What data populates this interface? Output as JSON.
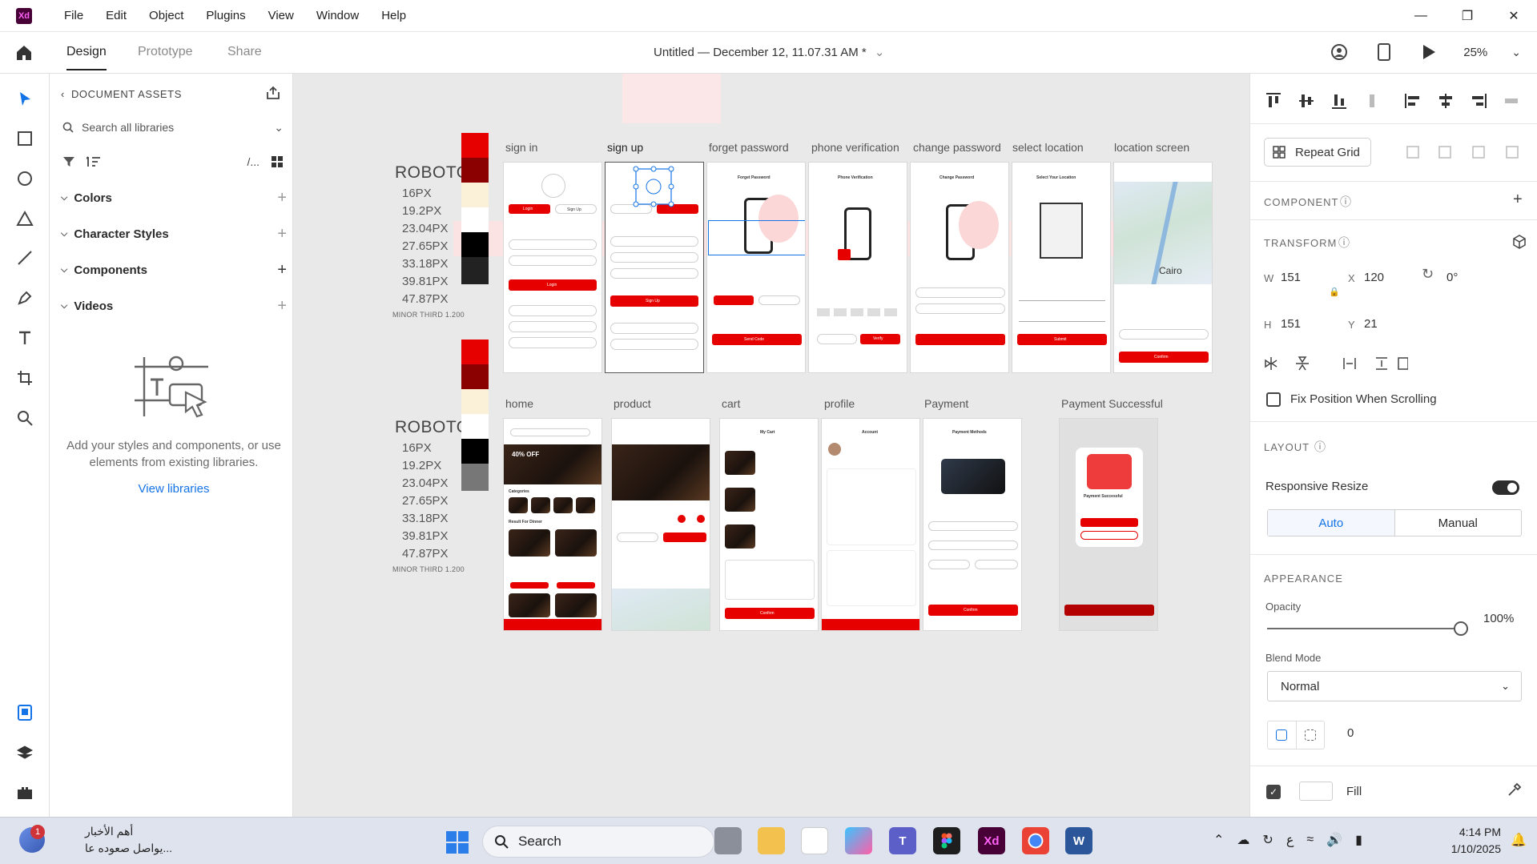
{
  "menu": [
    "File",
    "Edit",
    "Object",
    "Plugins",
    "View",
    "Window",
    "Help"
  ],
  "app_logo": "Xd",
  "modes": {
    "design": "Design",
    "prototype": "Prototype",
    "share": "Share"
  },
  "document_title": "Untitled — December 12, 11.07.31 AM *",
  "zoom": "25%",
  "assets": {
    "header": "DOCUMENT ASSETS",
    "search_placeholder": "Search all libraries",
    "filter_text": "/...",
    "sections": [
      "Colors",
      "Character Styles",
      "Components",
      "Videos"
    ],
    "empty_text": "Add your styles and components, or use elements from existing libraries.",
    "view_libraries": "View libraries"
  },
  "canvas": {
    "row1_labels": [
      "sign in",
      "sign up",
      "forget password",
      "phone verification",
      "change password",
      "select location",
      "location screen"
    ],
    "row2_labels": [
      "home",
      "product",
      "cart",
      "profile",
      "Payment",
      "Payment Successful"
    ],
    "typography": {
      "family": "ROBOTO",
      "sizes": [
        "16PX",
        "19.2PX",
        "23.04PX",
        "27.65PX",
        "33.18PX",
        "39.81PX",
        "47.87PX"
      ],
      "scale_note": "MINOR THIRD 1.200"
    },
    "palette": [
      "#e60000",
      "#8b0000",
      "#fbf1d9",
      "#ffffff",
      "#000000",
      "#222222"
    ],
    "palette2": [
      "#e60000",
      "#8b0000",
      "#fbf1d9",
      "#ffffff",
      "#000000",
      "#777777"
    ],
    "screen_text": {
      "login": "Login",
      "signup": "Sign Up",
      "forget_password": "Forget Password",
      "phone_verification": "Phone Verification",
      "change_password": "Change Password",
      "select_location": "Select Your Location",
      "location": "Location",
      "send_code": "Send Code",
      "verify": "Verify",
      "submit": "Submit",
      "confirm": "Confirm",
      "offer": "40% OFF",
      "categories": "Categories",
      "result_dinner": "Result For Dinner",
      "my_cart": "My Cart",
      "account": "Account",
      "payment_methods": "Payment Methods",
      "payment_success": "Payment Successful",
      "continue_shopping": "Continue Shopping",
      "track_delivery": "Track Delivery",
      "cairo": "Cairo"
    }
  },
  "props": {
    "repeat_grid": "Repeat Grid",
    "component_label": "COMPONENT",
    "transform_label": "TRANSFORM",
    "w_label": "W",
    "w_value": "151",
    "x_label": "X",
    "x_value": "120",
    "h_label": "H",
    "h_value": "151",
    "y_label": "Y",
    "y_value": "21",
    "rotation": "0°",
    "fix_position": "Fix Position When Scrolling",
    "layout_label": "LAYOUT",
    "responsive_resize": "Responsive Resize",
    "auto": "Auto",
    "manual": "Manual",
    "appearance_label": "APPEARANCE",
    "opacity_label": "Opacity",
    "opacity_value": "100%",
    "opacity_level": 1.0,
    "blend_label": "Blend Mode",
    "blend_value": "Normal",
    "corner_value": "0",
    "fill_label": "Fill"
  },
  "taskbar": {
    "news_badge": "1",
    "news_title": "أهم الأخبار",
    "news_sub": "يواصل صعوده عا...",
    "search": "Search",
    "time": "4:14 PM",
    "date": "1/10/2025",
    "lang": "ع"
  },
  "colors": {
    "accent": "#1473e6",
    "brand_red": "#e60000",
    "xd": "#470137"
  }
}
